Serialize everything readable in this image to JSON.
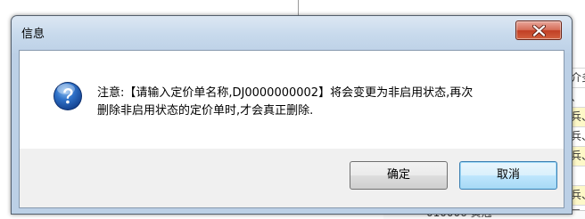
{
  "dialog": {
    "title": "信息",
    "message_line1": "注意:【请输入定价单名称,DJ0000000002】将会变更为非启用状态,再次",
    "message_line2": "删除非启用状态的定价单时,才会真正删除.",
    "ok_label": "确定",
    "cancel_label": "取消",
    "icon": "question-icon",
    "close_icon": "close-icon"
  },
  "background": {
    "row_fragments": [
      "介多",
      "、",
      "兵、",
      "兵、",
      "兵、",
      "",
      "兵、",
      "显"
    ],
    "bottom_text": "010006 黄冠",
    "highlight_color": "#fdf8c8"
  },
  "colors": {
    "title_gradient_top": "#dce7f3",
    "close_red": "#c13e24",
    "primary_border": "#3c7fb1"
  }
}
